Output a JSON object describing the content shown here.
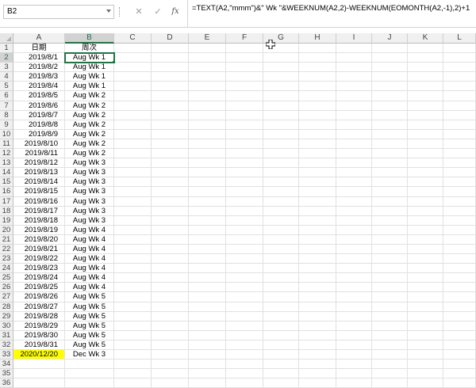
{
  "name_box": {
    "value": "B2"
  },
  "formula_bar": {
    "cancel_glyph": "✕",
    "enter_glyph": "✓",
    "fx_label": "fx",
    "formula": "=TEXT(A2,\"mmm\")&\" Wk \"&WEEKNUM(A2,2)-WEEKNUM(EOMONTH(A2,-1),2)+1"
  },
  "columns": [
    "A",
    "B",
    "C",
    "D",
    "E",
    "F",
    "G",
    "H",
    "I",
    "J",
    "K",
    "L"
  ],
  "selected_column": "B",
  "selected_row": 2,
  "rows": [
    {
      "n": "1",
      "a": "日期",
      "b": "周次"
    },
    {
      "n": "2",
      "a": "2019/8/1",
      "b": "Aug Wk 1"
    },
    {
      "n": "3",
      "a": "2019/8/2",
      "b": "Aug Wk 1"
    },
    {
      "n": "4",
      "a": "2019/8/3",
      "b": "Aug Wk 1"
    },
    {
      "n": "5",
      "a": "2019/8/4",
      "b": "Aug Wk 1"
    },
    {
      "n": "6",
      "a": "2019/8/5",
      "b": "Aug Wk 2"
    },
    {
      "n": "7",
      "a": "2019/8/6",
      "b": "Aug Wk 2"
    },
    {
      "n": "8",
      "a": "2019/8/7",
      "b": "Aug Wk 2"
    },
    {
      "n": "9",
      "a": "2019/8/8",
      "b": "Aug Wk 2"
    },
    {
      "n": "10",
      "a": "2019/8/9",
      "b": "Aug Wk 2"
    },
    {
      "n": "11",
      "a": "2019/8/10",
      "b": "Aug Wk 2"
    },
    {
      "n": "12",
      "a": "2019/8/11",
      "b": "Aug Wk 2"
    },
    {
      "n": "13",
      "a": "2019/8/12",
      "b": "Aug Wk 3"
    },
    {
      "n": "14",
      "a": "2019/8/13",
      "b": "Aug Wk 3"
    },
    {
      "n": "15",
      "a": "2019/8/14",
      "b": "Aug Wk 3"
    },
    {
      "n": "16",
      "a": "2019/8/15",
      "b": "Aug Wk 3"
    },
    {
      "n": "17",
      "a": "2019/8/16",
      "b": "Aug Wk 3"
    },
    {
      "n": "18",
      "a": "2019/8/17",
      "b": "Aug Wk 3"
    },
    {
      "n": "19",
      "a": "2019/8/18",
      "b": "Aug Wk 3"
    },
    {
      "n": "20",
      "a": "2019/8/19",
      "b": "Aug Wk 4"
    },
    {
      "n": "21",
      "a": "2019/8/20",
      "b": "Aug Wk 4"
    },
    {
      "n": "22",
      "a": "2019/8/21",
      "b": "Aug Wk 4"
    },
    {
      "n": "23",
      "a": "2019/8/22",
      "b": "Aug Wk 4"
    },
    {
      "n": "24",
      "a": "2019/8/23",
      "b": "Aug Wk 4"
    },
    {
      "n": "25",
      "a": "2019/8/24",
      "b": "Aug Wk 4"
    },
    {
      "n": "26",
      "a": "2019/8/25",
      "b": "Aug Wk 4"
    },
    {
      "n": "27",
      "a": "2019/8/26",
      "b": "Aug Wk 5"
    },
    {
      "n": "28",
      "a": "2019/8/27",
      "b": "Aug Wk 5"
    },
    {
      "n": "29",
      "a": "2019/8/28",
      "b": "Aug Wk 5"
    },
    {
      "n": "30",
      "a": "2019/8/29",
      "b": "Aug Wk 5"
    },
    {
      "n": "31",
      "a": "2019/8/30",
      "b": "Aug Wk 5"
    },
    {
      "n": "32",
      "a": "2019/8/31",
      "b": "Aug Wk 5"
    },
    {
      "n": "33",
      "a": "2020/12/20",
      "b": "Dec Wk 3",
      "highlight": true
    },
    {
      "n": "34",
      "a": "",
      "b": ""
    },
    {
      "n": "35",
      "a": "",
      "b": ""
    },
    {
      "n": "36",
      "a": "",
      "b": ""
    }
  ],
  "colors": {
    "highlight": "#ffff00",
    "selection": "#217346"
  }
}
